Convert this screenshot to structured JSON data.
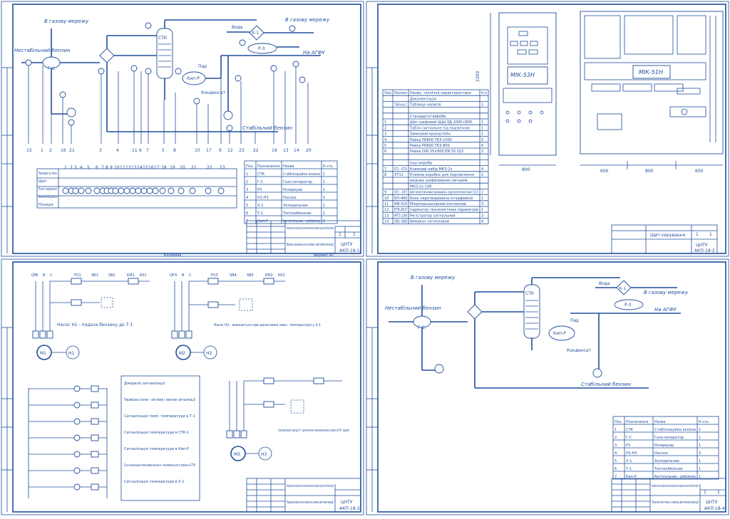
{
  "sheet1": {
    "labels": {
      "in_gas": "В газову мережу",
      "stable_gasoline_in": "Нестабільний бензин",
      "stk": "СТК",
      "water": "Вода",
      "in_gas2": "В газову мережу",
      "to_agfu": "На АГФУ",
      "steam": "Пар",
      "kip_r": "Кип-Р",
      "condensate": "Конденсат",
      "stable_gasoline_out": "Стабільний бензин",
      "gs": "Г-С",
      "re": "Р-3",
      "hh": "Х-1"
    },
    "bottom_numbers": [
      "15",
      "1",
      "2",
      "16",
      "21",
      "3",
      "4",
      "11",
      "6",
      "7",
      "5",
      "8",
      "10",
      "17",
      "9",
      "12",
      "23",
      "22",
      "19",
      "13",
      "14",
      "20"
    ],
    "panel_numbers": [
      "1",
      "2",
      "3",
      "4",
      "5",
      "6",
      "7",
      "8",
      "9",
      "10",
      "11",
      "12",
      "13",
      "14",
      "15",
      "16",
      "17",
      "18",
      "19",
      "20",
      "21",
      "22",
      "23"
    ],
    "left_headers": [
      "Прилади на місці",
      "Щит",
      "Пункт керування",
      "Вмикання/Керування",
      "Позиція"
    ],
    "table": {
      "headers": [
        "Поз.",
        "Позначення",
        "Назва",
        "К-сть"
      ],
      "rows": [
        [
          "1",
          "СТК",
          "Стабілізаційна колона",
          "1"
        ],
        [
          "2",
          "Г-С",
          "Газо-сепаратор",
          "1"
        ],
        [
          "3",
          "Р3",
          "Резервуар",
          "1"
        ],
        [
          "4",
          "Н1-Н3",
          "Насоси",
          "3"
        ],
        [
          "5",
          "Х-1",
          "Холодильник",
          "1"
        ],
        [
          "6",
          "Т-1",
          "Теплообмінник",
          "1"
        ],
        [
          "7",
          "Кип-Р",
          "Кип'ятильник - ребойлер",
          "1"
        ]
      ]
    },
    "stamp": {
      "title": "Розробка проектно-документації системи автоматичного керування процесом стабілізації нафти",
      "doc": "Функціональна схема автоматизації",
      "code": "АКП-18-1",
      "org": "ЦНТУ",
      "sheet": "1",
      "sheets": "1",
      "footer_left": "Копіював",
      "footer_right": "Формат А1"
    }
  },
  "sheet2": {
    "table": {
      "headers": [
        "Позиція",
        "Позначення",
        "Назва, технічна характеристика",
        "К-сть"
      ],
      "rows": [
        [
          "",
          "",
          "Документація",
          ""
        ],
        [
          "",
          "Таблиця 1",
          "Таблиця написів",
          "1"
        ],
        [
          "",
          "",
          "",
          ""
        ],
        [
          "",
          "",
          "Стандартні вироби",
          ""
        ],
        [
          "1",
          "",
          "Шит шафовий ЩШ-ЗД-1000×800",
          "1"
        ],
        [
          "2",
          "",
          "Табло сигнальне під підсвіткою",
          "1"
        ],
        [
          "3",
          "",
          "Замковий кронштейн",
          "1"
        ],
        [
          "4",
          "",
          "Рейка PR800 ТКЗ-1000",
          "5"
        ],
        [
          "5",
          "",
          "Рейка PR800 ТКЗ-800",
          "6"
        ],
        [
          "6",
          "",
          "Рейка DIN 35×800 EN 50 022",
          "2"
        ],
        [
          "",
          "",
          "",
          ""
        ],
        [
          "",
          "",
          "Інші вироби",
          ""
        ],
        [
          "7",
          "ХТ1 - ХТ10",
          "Клемний набір МКЗ-2х",
          "4"
        ],
        [
          "8",
          "ХТ11",
          "Клемна коробка для підключення",
          "1"
        ],
        [
          "",
          "",
          "вхідних уніфікованих сигналів",
          ""
        ],
        [
          "",
          "",
          "МКЗ-2х-108",
          ""
        ],
        [
          "9",
          "QF1 - QF2",
          "Автоматичний вимикач однополюсний S11",
          "2"
        ],
        [
          "10",
          "БП-485",
          "Блок перетворювача інтерфейсів",
          "1"
        ],
        [
          "11",
          "МІК-51Н",
          "Мікропроцесорний контролер",
          "3"
        ],
        [
          "12",
          "ЕТФ-2007",
          "Індикатор технологічних параметрів",
          "1"
        ],
        [
          "13",
          "МТЗ-108",
          "Регістратор сигнальний",
          "3"
        ],
        [
          "14",
          "SB1-SB8",
          "Вимикач натисковий",
          "8"
        ]
      ]
    },
    "dims": {
      "height": "2200",
      "width_front": "800",
      "w_left": "600",
      "w_mid": "800",
      "w_right": "600"
    },
    "ctrl_label": "МІК-51Н",
    "ctrl_label2": "МІК-53Н",
    "stamp": {
      "title": "Щит керування",
      "code": "АКП-18-2",
      "org": "ЦНТУ",
      "sheet": "1",
      "sheets": "1"
    }
  },
  "sheet3": {
    "top_labels_a": [
      "QF",
      "A",
      "B",
      "C",
      "FU1",
      "SB1",
      "SB2",
      "KM1",
      "KK1"
    ],
    "top_labels_b": [
      "QF",
      "A",
      "B",
      "C",
      "FU3",
      "SB4",
      "SB5",
      "KM2",
      "KK2"
    ],
    "caption_a": "Насос Н1 - подача бензину до Т-1",
    "caption_b": "Насос Н2 - вмикається при досягненні макс. температури у Х-1",
    "caption_c": "Сигналізація напору Р - досягнення максимального рівня в Р3 і подачі",
    "motors": [
      "М1",
      "Н1",
      "М2",
      "Н2",
      "М3",
      "Н3"
    ],
    "signal_rows": [
      "Джерело сигналізації",
      "Перевірка схеми - світлове і звукове сигналізації",
      "Сигналізація темп. температури в Т-1",
      "Сигналізація температури в СТК-1",
      "Сигналізація температури в Кип-Р",
      "Сигналізація максимального і мінімального рівня в СТК",
      "Сигналізація температури в Х-1"
    ],
    "stamp": {
      "title": "Розробка проектно-документації системи автоматичного керування процесом стабілізації нафти",
      "doc": "Принципова електрична схема автоматизації",
      "code": "АКП-18-3",
      "org": "ЦНТУ"
    }
  },
  "sheet4": {
    "labels": {
      "in_gas": "В газову мережу",
      "stable_gasoline_in": "Нестабільний бензин",
      "stk": "СТК",
      "water": "Вода",
      "in_gas2": "В газову мережу",
      "to_agfu": "На АГФУ",
      "steam": "Пар",
      "kip_r": "Кип-Р",
      "condensate": "Конденсат",
      "stable_gasoline_out": "Стабільний бензин",
      "gs": "Г-С",
      "re": "Р-3",
      "hh": "Х-1"
    },
    "table": {
      "headers": [
        "Поз.",
        "Позначення",
        "Назва",
        "К-сть"
      ],
      "rows": [
        [
          "1",
          "СТК",
          "Стабілізаційна колона",
          "1"
        ],
        [
          "2",
          "Г-С",
          "Газо-сепаратор",
          "1"
        ],
        [
          "3",
          "Р3",
          "Резервуар",
          "1"
        ],
        [
          "4",
          "Н1-Н3",
          "Насоси",
          "3"
        ],
        [
          "5",
          "Х-1",
          "Холодильник",
          "1"
        ],
        [
          "6",
          "Т-1",
          "Теплообмінник",
          "1"
        ],
        [
          "7",
          "Кип-Р",
          "Кип'ятильник - ребойлер",
          "1"
        ]
      ]
    },
    "stamp": {
      "title": "Розробка проектно-документації системи автоматичного керування процесом стабілізації нафти",
      "doc": "Технологічна схема автоматизації",
      "code": "АКП-18-4",
      "org": "ЦНТУ",
      "sheet": "1",
      "sheets": "1"
    }
  }
}
